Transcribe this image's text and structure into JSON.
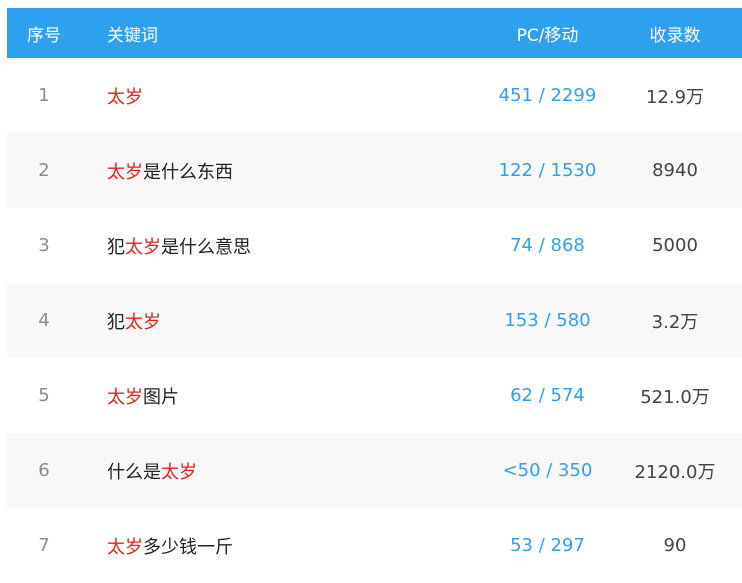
{
  "header": {
    "index": "序号",
    "keyword": "关键词",
    "pc_mobile": "PC/移动",
    "records": "收录数"
  },
  "rows": [
    {
      "index": "1",
      "keyword": [
        {
          "t": "太岁",
          "hl": true
        }
      ],
      "pc_mobile": "451 / 2299",
      "records": "12.9万"
    },
    {
      "index": "2",
      "keyword": [
        {
          "t": "太岁",
          "hl": true
        },
        {
          "t": "是什么东西",
          "hl": false
        }
      ],
      "pc_mobile": "122 / 1530",
      "records": "8940"
    },
    {
      "index": "3",
      "keyword": [
        {
          "t": "犯",
          "hl": false
        },
        {
          "t": "太岁",
          "hl": true
        },
        {
          "t": "是什么意思",
          "hl": false
        }
      ],
      "pc_mobile": "74 / 868",
      "records": "5000"
    },
    {
      "index": "4",
      "keyword": [
        {
          "t": "犯",
          "hl": false
        },
        {
          "t": "太岁",
          "hl": true
        }
      ],
      "pc_mobile": "153 / 580",
      "records": "3.2万"
    },
    {
      "index": "5",
      "keyword": [
        {
          "t": "太岁",
          "hl": true
        },
        {
          "t": "图片",
          "hl": false
        }
      ],
      "pc_mobile": "62 / 574",
      "records": "521.0万"
    },
    {
      "index": "6",
      "keyword": [
        {
          "t": "什么是",
          "hl": false
        },
        {
          "t": "太岁",
          "hl": true
        }
      ],
      "pc_mobile": "<50 / 350",
      "records": "2120.0万"
    },
    {
      "index": "7",
      "keyword": [
        {
          "t": "太岁",
          "hl": true
        },
        {
          "t": "多少钱一斤",
          "hl": false
        }
      ],
      "pc_mobile": "53 / 297",
      "records": "90"
    }
  ],
  "colors": {
    "header_bg": "#2ea1ee",
    "highlight": "#e8221a",
    "metric": "#2ea1ee",
    "alt_row": "#f8f8f8"
  }
}
